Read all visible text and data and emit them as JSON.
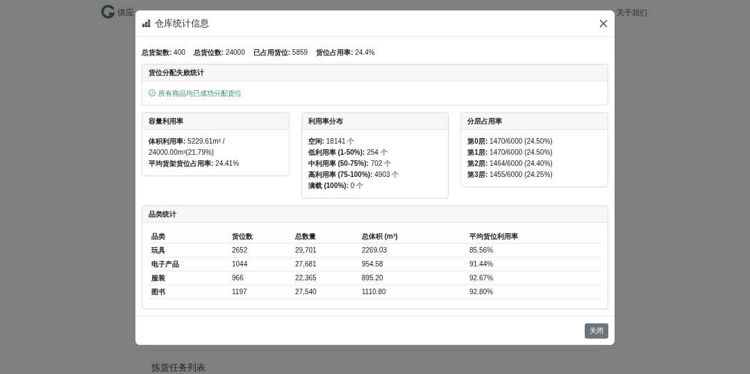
{
  "background": {
    "brand_text": "供应",
    "nav_links": [
      "关于我们"
    ],
    "section_title": "拣货任务列表"
  },
  "modal": {
    "title": "仓库统计信息",
    "summary": [
      {
        "label": "总货架数:",
        "value": "400"
      },
      {
        "label": "总货位数:",
        "value": "24000"
      },
      {
        "label": "已占用货位:",
        "value": "5859"
      },
      {
        "label": "货位占用率:",
        "value": "24.4%"
      }
    ],
    "failure_card": {
      "title": "货位分配失败统计",
      "message": "所有商品均已成功分配货位"
    },
    "cards": [
      {
        "title": "容量利用率",
        "lines": [
          {
            "label": "体积利用率:",
            "value": "5229.61m³ / 24000.00m³(21.79%)"
          },
          {
            "label": "平均货架货位占用率:",
            "value": "24.41%"
          }
        ]
      },
      {
        "title": "利用率分布",
        "lines": [
          {
            "label": "空闲:",
            "value": "18141 个"
          },
          {
            "label": "低利用率 (1-50%):",
            "value": "254 个"
          },
          {
            "label": "中利用率 (50-75%):",
            "value": "702 个"
          },
          {
            "label": "高利用率 (75-100%):",
            "value": "4903 个"
          },
          {
            "label": "满载 (100%):",
            "value": "0 个"
          }
        ]
      },
      {
        "title": "分层占用率",
        "lines": [
          {
            "label": "第0层:",
            "value": "1470/6000 (24.50%)"
          },
          {
            "label": "第1层:",
            "value": "1470/6000 (24.50%)"
          },
          {
            "label": "第2层:",
            "value": "1464/6000 (24.40%)"
          },
          {
            "label": "第3层:",
            "value": "1455/6000 (24.25%)"
          }
        ]
      }
    ],
    "category_card": {
      "title": "品类统计",
      "columns": [
        "品类",
        "货位数",
        "总数量",
        "总体积 (m³)",
        "平均货位利用率"
      ],
      "rows": [
        [
          "玩具",
          "2652",
          "29,701",
          "2269.03",
          "85.56%"
        ],
        [
          "电子产品",
          "1044",
          "27,681",
          "954.58",
          "91.44%"
        ],
        [
          "服装",
          "966",
          "22,365",
          "895.20",
          "92.67%"
        ],
        [
          "图书",
          "1197",
          "27,540",
          "1110.80",
          "92.80%"
        ]
      ]
    },
    "close_button": "关闭"
  }
}
